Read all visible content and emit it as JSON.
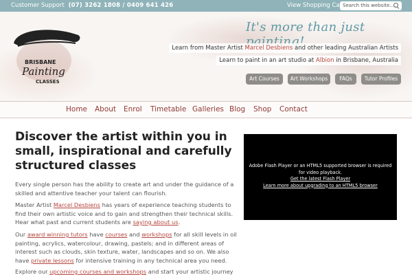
{
  "topbar": {
    "support_label": "Customer Support",
    "phone": "(07) 3262 1808 / 0409 641 426",
    "cart_link": "View Shopping Cart",
    "search_placeholder": "Search this website..."
  },
  "header": {
    "tagline": "It's more than just painting!",
    "line1_pre": "Learn from Master Artist ",
    "line1_link": "Marcel Desbiens",
    "line1_post": " and other leading Australian Artists",
    "line2_pre": "Learn to paint in an art studio at ",
    "line2_link": "Albion",
    "line2_post": " in Brisbane, Australia",
    "pills": [
      "Art Courses",
      "Art Workshops",
      "FAQs",
      "Tutor Profiles"
    ]
  },
  "logo": {
    "word1": "BRISBANE",
    "word2": "Painting",
    "word3": "CLASSES"
  },
  "nav": [
    "Home",
    "About",
    "Enrol",
    "Timetable",
    "Galleries",
    "Blog",
    "Shop",
    "Contact"
  ],
  "main": {
    "headline": "Discover the artist within you in small, inspirational and carefully structured classes",
    "p1": "Every single person has the ability to create art and under the guidance of a skilled and attentive teacher your talent can flourish.",
    "p2_pre": "Master Artist ",
    "p2_link1": "Marcel Desbiens",
    "p2_mid": " has years of experience teaching students to find their own artistic voice and to gain and strengthen their technical skills. Hear what past and current students are ",
    "p2_link2": "saying about us",
    "p2_post": ".",
    "p3_pre": "Our ",
    "p3_link1": "award winning tutors",
    "p3_t1": " have ",
    "p3_link2": "courses",
    "p3_t2": " and ",
    "p3_link3": "workshops",
    "p3_t3": " for all skill levels in oil painting, acrylics, watercolour, drawing, pastels; and in different areas of interest such as clouds, skin texture, water, landscapes and so on. We also have ",
    "p3_link4": "private lessons",
    "p3_t4": " for intensive training in any technical area you need.",
    "p4_pre": "Explore our ",
    "p4_link": "upcoming courses and workshops",
    "p4_post": " and start your artistic journey"
  },
  "video": {
    "message": "Adobe Flash Player or an HTML5 supported browser is required for video playback.",
    "link1": "Get the latest Flash Player",
    "link2": "Learn more about upgrading to an HTML5 browser"
  },
  "colors": {
    "topbar": "#8fb3b9",
    "accent": "#b5453d",
    "nav_text": "#8f3a35",
    "tagline": "#5d9aa3"
  }
}
